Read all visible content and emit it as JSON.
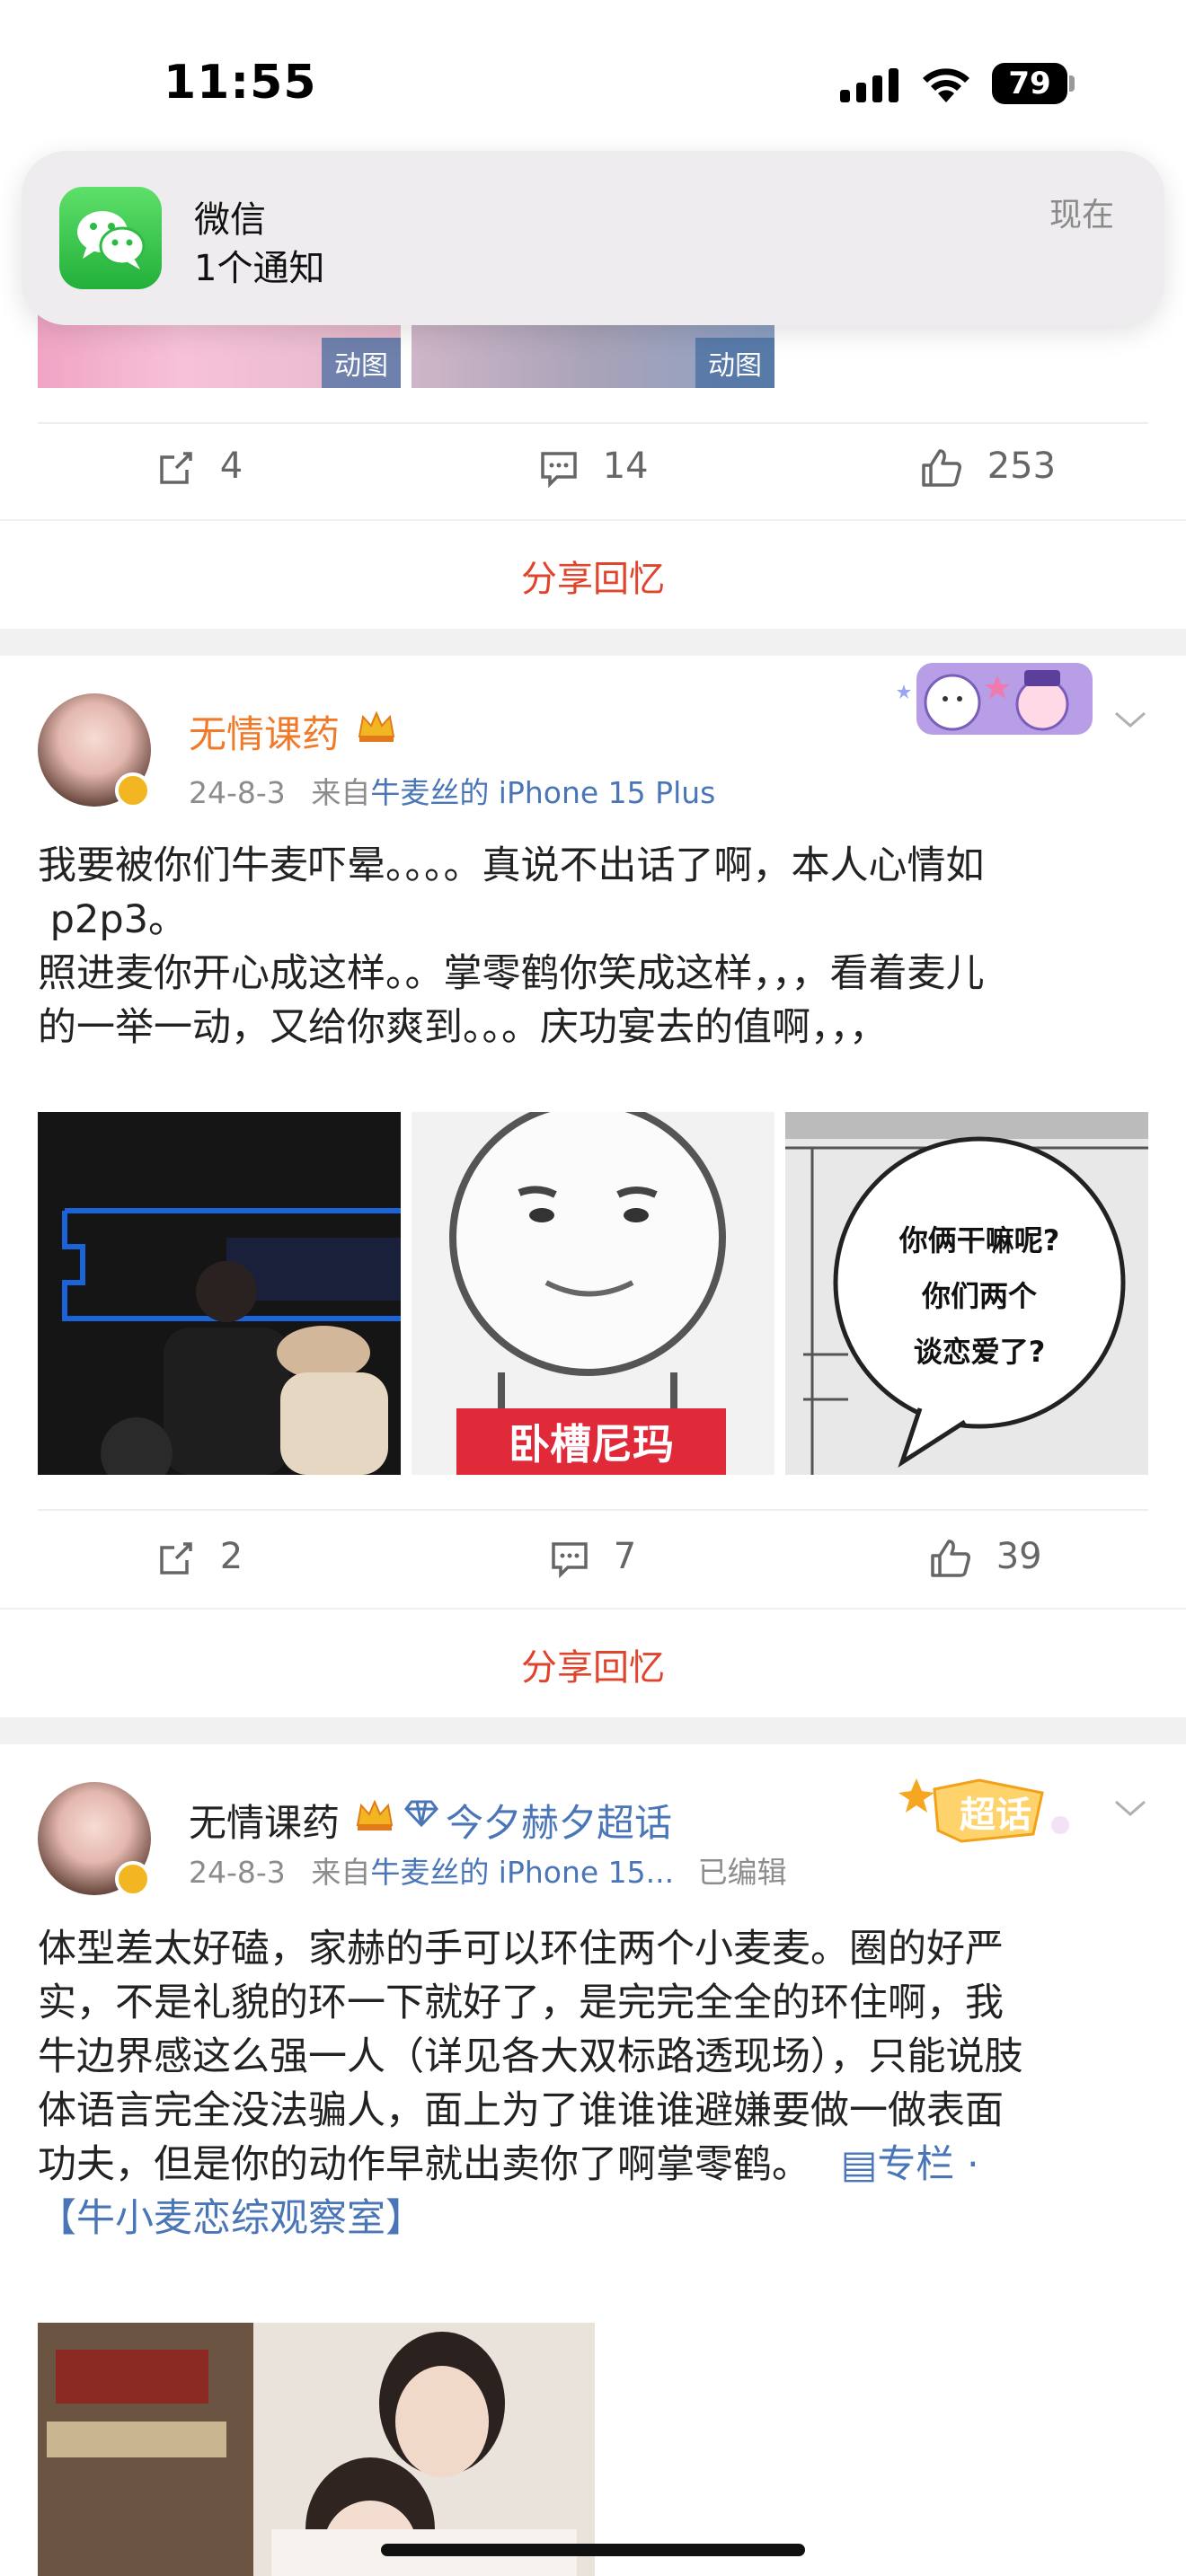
{
  "status_bar": {
    "time": "11:55",
    "battery": "79"
  },
  "notification": {
    "app": "微信",
    "message": "1个通知",
    "time": "现在"
  },
  "post1": {
    "gif_label_1": "动图",
    "gif_label_2": "动图",
    "repost_count": "4",
    "comment_count": "14",
    "like_count": "253",
    "share_label": "分享回忆"
  },
  "post2": {
    "username": "无情课药",
    "date": "24-8-3",
    "source_prefix": "来自",
    "source_device": "牛麦丝的 iPhone 15 Plus",
    "text_line1": "我要被你们牛麦吓晕。。。。真说不出话了啊，本人心情如",
    "text_line2": " p2p3。",
    "text_line3": "照进麦你开心成这样。。掌零鹤你笑成这样，，，看着麦儿",
    "text_line4": "的一举一动，又给你爽到。。。庆功宴去的值啊，，，",
    "img2_caption": "卧槽尼玛",
    "img3_line1": "你俩干嘛呢?",
    "img3_line2": "你们两个",
    "img3_line3": "谈恋爱了?",
    "repost_count": "2",
    "comment_count": "7",
    "like_count": "39",
    "share_label": "分享回忆"
  },
  "post3": {
    "username": "无情课药",
    "topic": "今夕赫夕超话",
    "date": "24-8-3",
    "source_prefix": "来自",
    "source_device": "牛麦丝的 iPhone 15...",
    "edited": "已编辑",
    "badge_text": "超话",
    "text_line1": "体型差太好磕，家赫的手可以环住两个小麦麦。圈的好严",
    "text_line2": "实，不是礼貌的环一下就好了，是完完全全的环住啊，我",
    "text_line3": "牛边界感这么强一人（详见各大双标路透现场），只能说肢",
    "text_line4": "体语言完全没法骗人，面上为了谁谁谁避嫌要做一做表面",
    "text_line5": "功夫，但是你的动作早就出卖你了啊掌零鹤。",
    "column_label": "专栏",
    "column_title": "【牛小麦恋综观察室】"
  },
  "icons": [
    "signal-icon",
    "wifi-icon",
    "wechat-icon",
    "repost-icon",
    "comment-icon",
    "like-icon",
    "crown-icon",
    "verified-icon",
    "chevron-down-icon",
    "diamond-icon",
    "column-icon"
  ]
}
